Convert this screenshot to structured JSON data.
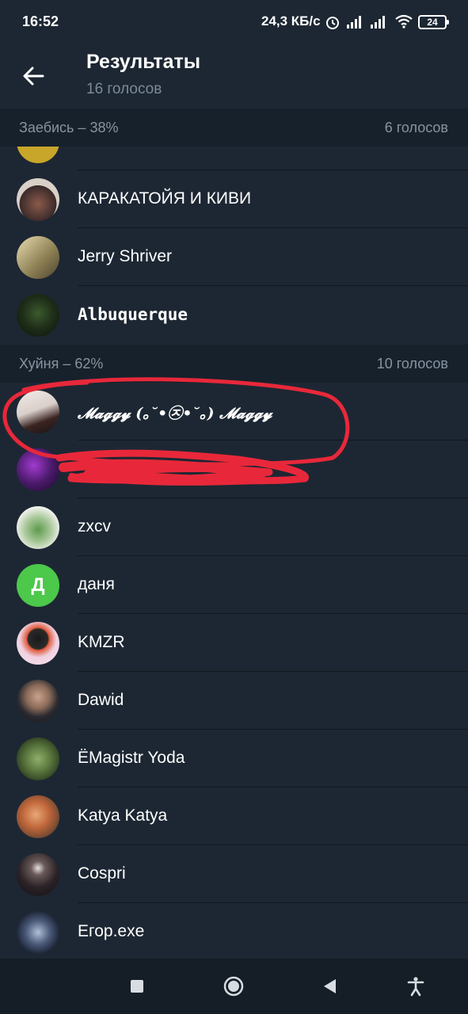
{
  "status": {
    "time": "16:52",
    "net": "24,3 КБ/с",
    "battery": "24"
  },
  "header": {
    "title": "Результаты",
    "subtitle": "16 голосов"
  },
  "sections": [
    {
      "label": "Заебись – 38%",
      "count": "6 голосов"
    },
    {
      "label": "Хуйня – 62%",
      "count": "10 голосов"
    }
  ],
  "section1_rows": [
    {
      "name": "КАРАКАТОЙЯ И КИВИ"
    },
    {
      "name": "Jerry Shriver"
    },
    {
      "name": "Albuquerque"
    }
  ],
  "section2_rows": [
    {
      "name": "𝓜𝓪𝓰𝓰𝔂 (｡˘•㉨•˘｡) 𝓜𝓪𝓰𝓰𝔂"
    },
    {
      "name": ""
    },
    {
      "name": "zxcv"
    },
    {
      "name": "даня",
      "initial": "Д"
    },
    {
      "name": "KMZR"
    },
    {
      "name": "Dawid"
    },
    {
      "name": "ЁMagistr Yoda"
    },
    {
      "name": "Katya Katya"
    },
    {
      "name": "Cospri"
    },
    {
      "name": "Егор.exe"
    }
  ],
  "colors": {
    "bg": "#1d2733",
    "section_bg": "#17212b",
    "accent_green": "#4cc84a",
    "scribble": "#e8283a"
  }
}
